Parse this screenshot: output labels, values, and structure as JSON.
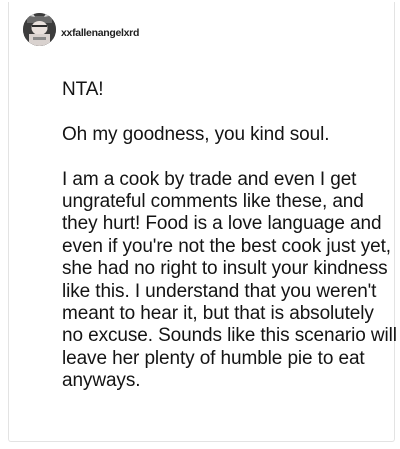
{
  "post": {
    "author": {
      "username": "xxfallenangelxrd",
      "avatar_icon": "avatar-icon"
    },
    "paragraphs": [
      "NTA!",
      "Oh my goodness, you kind soul.",
      "I am a cook by trade and even I get ungrateful comments like these, and they hurt! Food is a love language and even if you're not the best cook just yet, she had no right to insult your kindness like this. I understand that you weren't meant to hear it, but that is absolutely no excuse. Sounds like this scenario will leave her plenty of humble pie to eat anyways."
    ]
  }
}
